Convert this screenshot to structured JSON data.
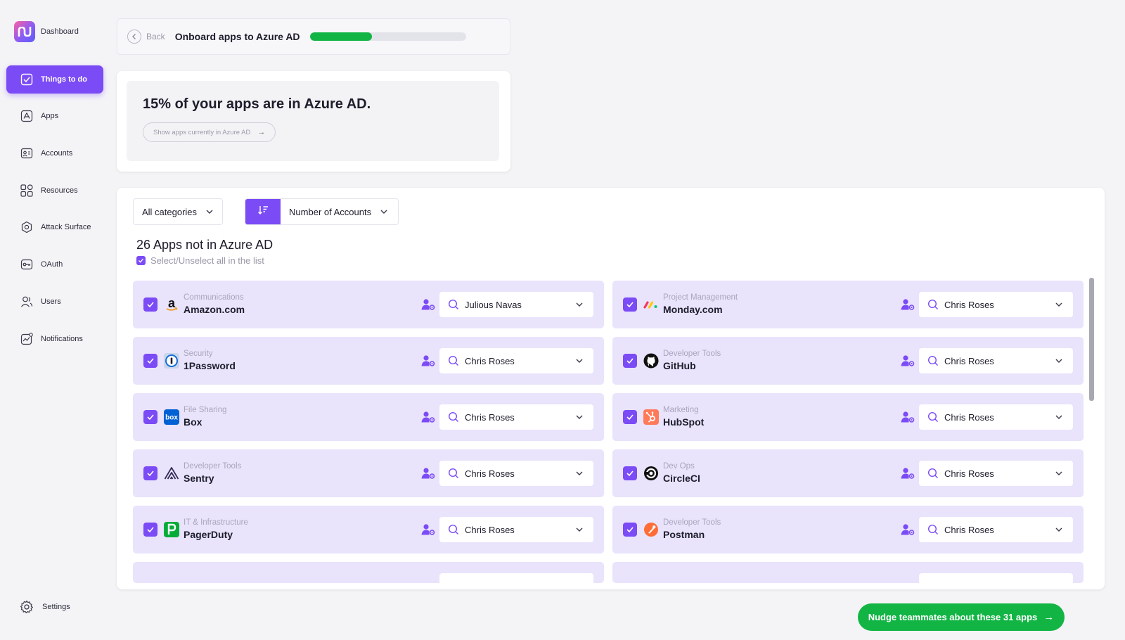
{
  "sidebar": {
    "logo_label": "Dashboard",
    "items": [
      {
        "label": "Things to do",
        "icon": "check-square-icon",
        "active": true
      },
      {
        "label": "Apps",
        "icon": "apps-icon",
        "active": false
      },
      {
        "label": "Accounts",
        "icon": "accounts-icon",
        "active": false
      },
      {
        "label": "Resources",
        "icon": "resources-icon",
        "active": false
      },
      {
        "label": "Attack Surface",
        "icon": "attack-surface-icon",
        "active": false
      },
      {
        "label": "OAuth",
        "icon": "oauth-key-icon",
        "active": false
      },
      {
        "label": "Users",
        "icon": "users-icon",
        "active": false
      },
      {
        "label": "Notifications",
        "icon": "notifications-icon",
        "active": false
      }
    ],
    "settings_label": "Settings"
  },
  "header": {
    "back_label": "Back",
    "title": "Onboard apps to Azure AD",
    "progress_fraction": 0.4
  },
  "summary": {
    "headline": "15% of your apps are in Azure AD.",
    "show_button": "Show apps currently in Azure AD"
  },
  "filters": {
    "category": "All categories",
    "sort_by": "Number of Accounts"
  },
  "list": {
    "title": "26 Apps not in Azure AD",
    "select_all_label": "Select/Unselect all in the list",
    "apps": [
      {
        "category": "Communications",
        "name": "Amazon.com",
        "owner": "Julious Navas",
        "logo": "amazon-logo",
        "checked": true
      },
      {
        "category": "Project Management",
        "name": "Monday.com",
        "owner": "Chris Roses",
        "logo": "monday-logo",
        "checked": true
      },
      {
        "category": "Security",
        "name": "1Password",
        "owner": "Chris Roses",
        "logo": "1password-logo",
        "checked": true
      },
      {
        "category": "Developer Tools",
        "name": "GitHub",
        "owner": "Chris Roses",
        "logo": "github-logo",
        "checked": true
      },
      {
        "category": "File Sharing",
        "name": "Box",
        "owner": "Chris Roses",
        "logo": "box-logo",
        "checked": true
      },
      {
        "category": "Marketing",
        "name": "HubSpot",
        "owner": "Chris Roses",
        "logo": "hubspot-logo",
        "checked": true
      },
      {
        "category": "Developer Tools",
        "name": "Sentry",
        "owner": "Chris Roses",
        "logo": "sentry-logo",
        "checked": true
      },
      {
        "category": "Dev Ops",
        "name": "CircleCI",
        "owner": "Chris Roses",
        "logo": "circleci-logo",
        "checked": true
      },
      {
        "category": "IT & Infrastructure",
        "name": "PagerDuty",
        "owner": "Chris Roses",
        "logo": "pagerduty-logo",
        "checked": true
      },
      {
        "category": "Developer Tools",
        "name": "Postman",
        "owner": "Chris Roses",
        "logo": "postman-logo",
        "checked": true
      }
    ]
  },
  "footer": {
    "nudge_button": "Nudge teammates about these 31 apps"
  },
  "colors": {
    "accent": "#7b4bf5",
    "row_bg": "#e9e3fc",
    "success": "#12b544",
    "page_bg": "#f4f4f7"
  }
}
